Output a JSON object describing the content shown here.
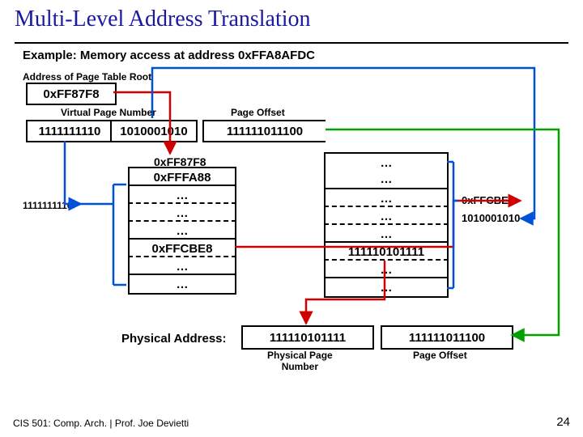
{
  "title": "Multi-Level Address Translation",
  "example": "Example:  Memory access at address 0xFFA8AFDC",
  "root_label": "Address of Page Table Root",
  "root_value": "0xFF87F8",
  "vpn_label": "Virtual Page Number",
  "offset_label": "Page Offset",
  "vpn1": "1111111110",
  "vpn2": "1010001010",
  "offset": "111111011100",
  "table1": {
    "header": "0xFF87F8",
    "rows": [
      "0xFFFA88",
      "…",
      "…",
      "…",
      "0xFFCBE8",
      "…",
      "…"
    ]
  },
  "table2": {
    "rows": [
      "…",
      "…",
      "…",
      "…",
      "…",
      "111110101111",
      "…",
      "…"
    ]
  },
  "idx1_side": "1111111110",
  "idx2_right": "0xFFCBE8",
  "idx2_right2": "1010001010",
  "phys_addr_label": "Physical Address:",
  "phys_page": "111110101111",
  "phys_offset": "111111011100",
  "phys_page_label": "Physical Page\nNumber",
  "phys_offset_label": "Page Offset",
  "footer_left": "CIS 501: Comp. Arch.  |  Prof. Joe Devietti",
  "footer_right": "24"
}
